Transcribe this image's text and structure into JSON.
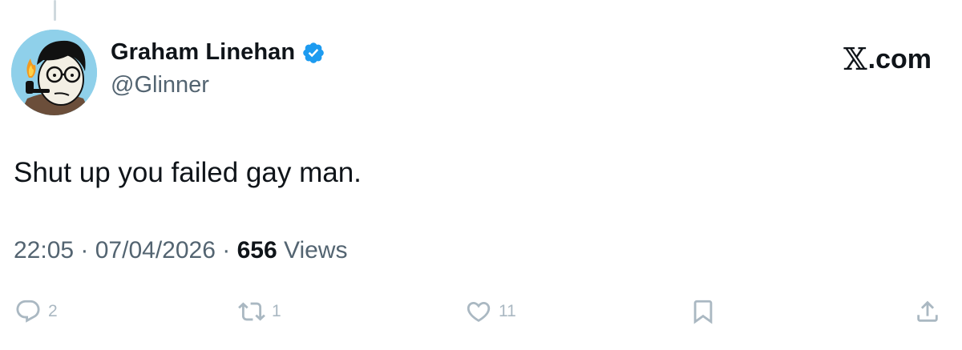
{
  "author": {
    "display_name": "Graham Linehan",
    "handle": "@Glinner",
    "verified": true
  },
  "brand": {
    "x_symbol": "𝕏",
    "suffix": ".com"
  },
  "tweet": {
    "text": "Shut up you failed gay man.",
    "time": "22:05",
    "separator": " · ",
    "date": "07/04/2026",
    "views_count": "656",
    "views_label": " Views"
  },
  "actions": {
    "replies": "2",
    "reposts": "1",
    "likes": "11"
  },
  "icons": {
    "reply": "reply-icon",
    "repost": "repost-icon",
    "like": "heart-icon",
    "bookmark": "bookmark-icon",
    "share": "share-icon",
    "verified": "verified-badge-icon"
  },
  "colors": {
    "text": "#0f1419",
    "secondary": "#536471",
    "verified": "#1d9bf0",
    "actions_faded": "#aab8c2"
  }
}
